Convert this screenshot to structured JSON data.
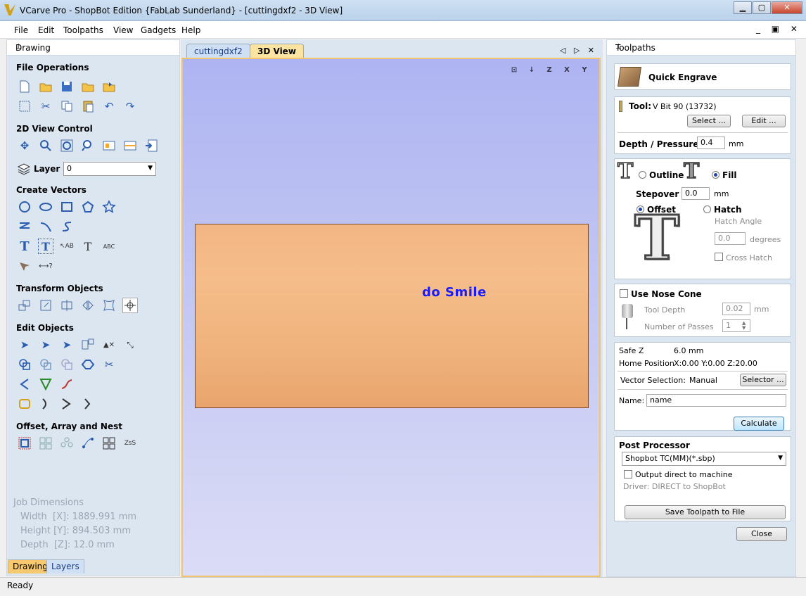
{
  "window": {
    "title": "VCarve Pro - ShopBot Edition {FabLab Sunderland} - [cuttingdxf2 - 3D View]",
    "min": "▁",
    "max": "▢",
    "close": "✕"
  },
  "menu": [
    "File",
    "Edit",
    "Toolpaths",
    "View",
    "Gadgets",
    "Help"
  ],
  "left_panel": {
    "title": "Drawing",
    "pin": "⊥",
    "sections": {
      "file_ops": "File Operations",
      "view_control": "2D View Control",
      "create_vectors": "Create Vectors",
      "transform": "Transform Objects",
      "edit": "Edit Objects",
      "offset": "Offset, Array and Nest"
    },
    "layer_label": "Layer",
    "layer_value": "0",
    "job": {
      "title": "Job Dimensions",
      "width": "Width  [X]: 1889.991 mm",
      "height": "Height [Y]: 894.503 mm",
      "depth": "Depth  [Z]: 12.0 mm"
    },
    "tabs": [
      "Drawing",
      "Layers"
    ]
  },
  "center": {
    "tabs": [
      "cuttingdxf2",
      "3D View"
    ],
    "board_text": "do Smile",
    "view_icons": [
      "⊡",
      "↓",
      "Z",
      "X",
      "Y"
    ]
  },
  "right_panel": {
    "title": "Toolpaths",
    "pin": "⊥",
    "heading": "Quick Engrave",
    "tool_label": "Tool:",
    "tool_value": "V Bit 90 (13732)",
    "select_btn": "Select ...",
    "edit_btn": "Edit ...",
    "depth_label": "Depth / Pressure",
    "depth_value": "0.4",
    "mm": "mm",
    "outline": "Outline",
    "fill": "Fill",
    "stepover_label": "Stepover",
    "stepover_value": "0.0",
    "offset": "Offset",
    "hatch": "Hatch",
    "hatch_angle": "Hatch Angle",
    "angle_value": "0.0",
    "degrees": "degrees",
    "cross_hatch": "Cross Hatch",
    "nose_cone": "Use Nose Cone",
    "tool_depth": "Tool Depth",
    "tool_depth_value": "0.02",
    "passes": "Number of Passes",
    "passes_value": "1",
    "safe_z_label": "Safe Z",
    "safe_z_value": "6.0 mm",
    "home_label": "Home Position",
    "home_value": "X:0.00 Y:0.00 Z:20.00",
    "vector_sel_label": "Vector Selection:",
    "vector_sel_value": "Manual",
    "selector_btn": "Selector ...",
    "name_label": "Name:",
    "name_value": "name",
    "calculate": "Calculate",
    "post_title": "Post Processor",
    "post_value": "Shopbot TC(MM)(*.sbp)",
    "output_direct": "Output direct to machine",
    "driver": "Driver:  DIRECT to ShopBot",
    "save_btn": "Save Toolpath to File",
    "close_btn": "Close"
  },
  "status": "Ready"
}
